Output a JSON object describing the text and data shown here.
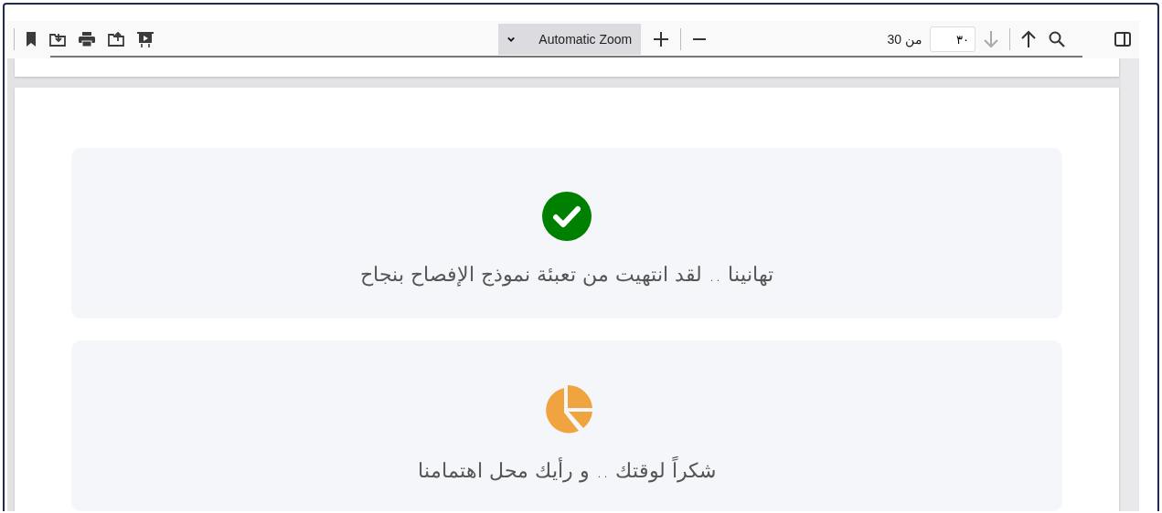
{
  "toolbar": {
    "zoom_select": {
      "value": "Automatic Zoom"
    },
    "page_number": {
      "value": "٣٠"
    },
    "page_count": "من 30"
  },
  "cards": [
    {
      "kind": "success",
      "message": "تهانينا .. لقد انتهيت من تعبئة نموذج الإفصاح بنجاح"
    },
    {
      "kind": "chart",
      "message": "شكراً لوقتك .. و رأيك محل اهتمامنا"
    }
  ]
}
